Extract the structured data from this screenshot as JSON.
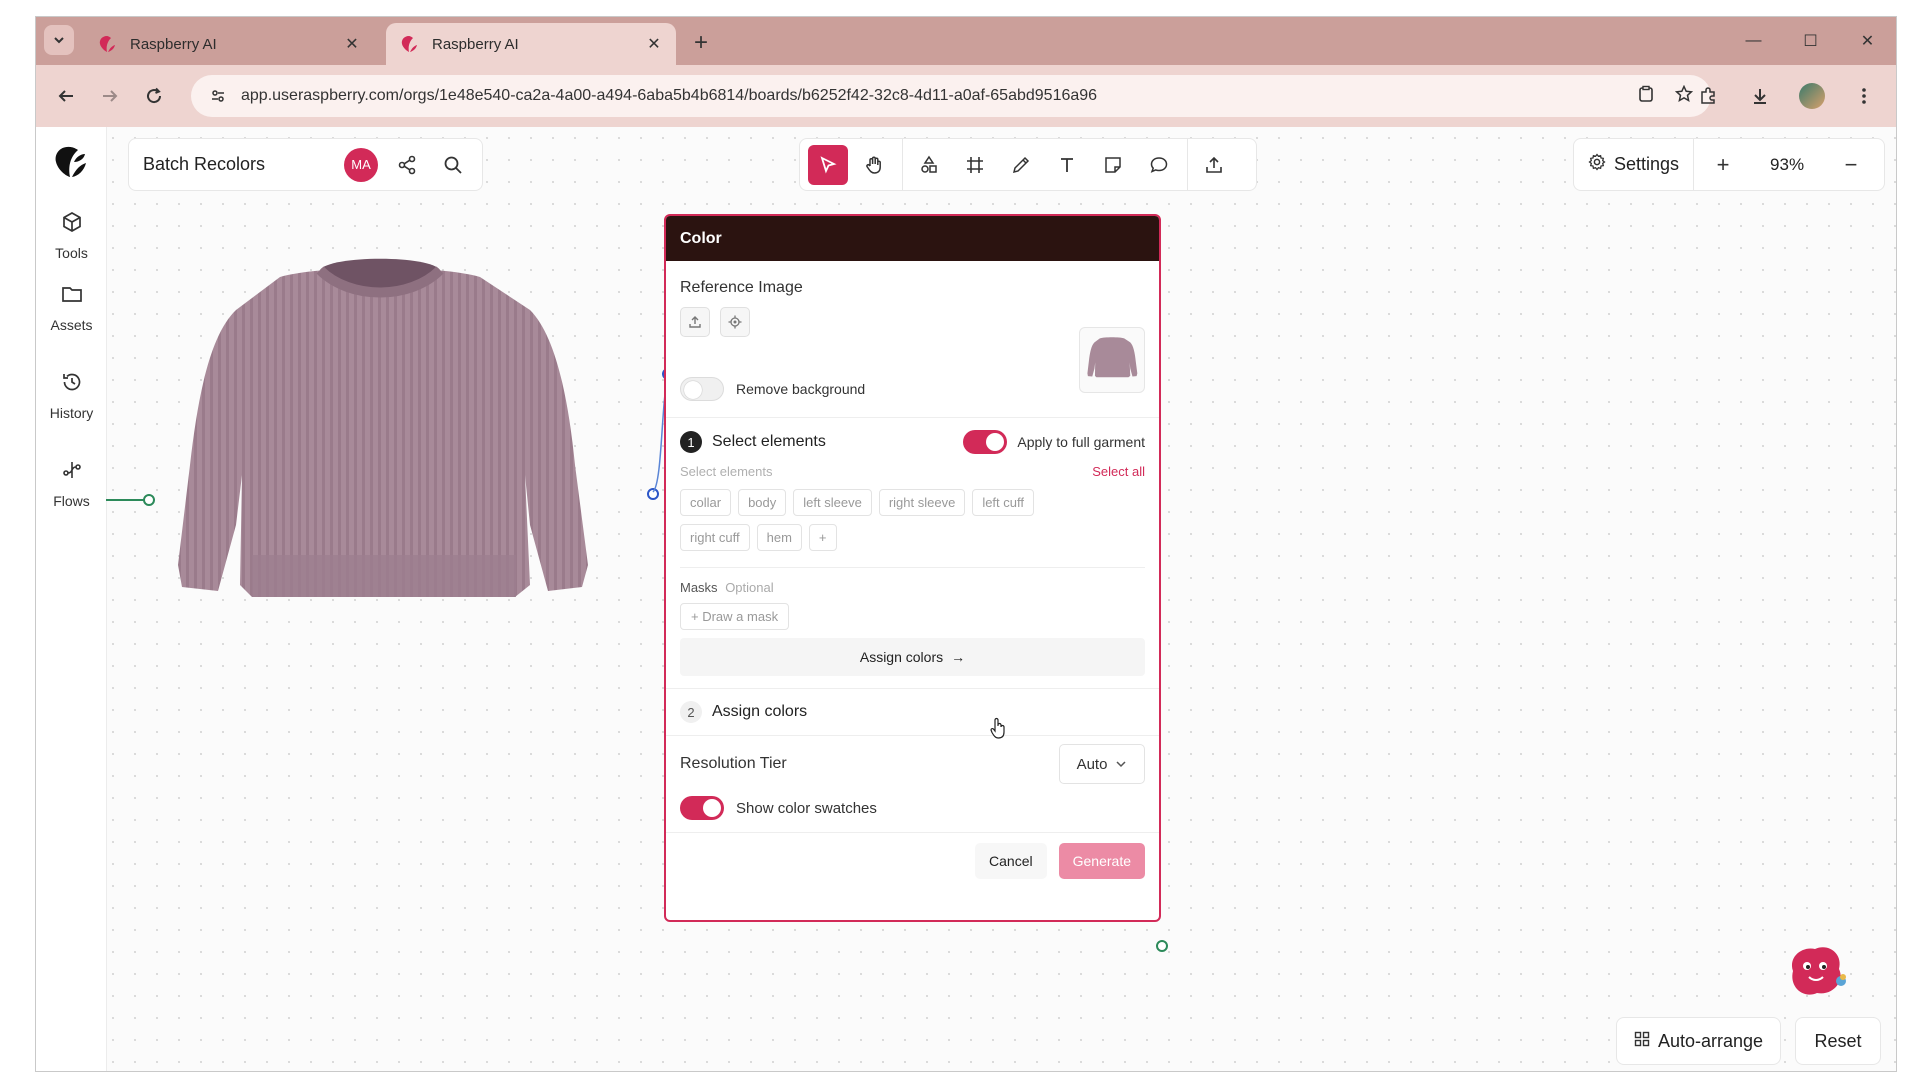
{
  "browser": {
    "tabs": [
      {
        "title": "Raspberry AI",
        "active": false
      },
      {
        "title": "Raspberry AI",
        "active": true
      }
    ],
    "url": "app.useraspberry.com/orgs/1e48e540-ca2a-4a00-a494-6aba5b4b6814/boards/b6252f42-32c8-4d11-a0af-65abd9516a96"
  },
  "sidebar": {
    "items": [
      {
        "label": "Tools",
        "icon": "tools-icon"
      },
      {
        "label": "Assets",
        "icon": "folder-icon"
      },
      {
        "label": "History",
        "icon": "history-icon"
      },
      {
        "label": "Flows",
        "icon": "flows-icon"
      }
    ]
  },
  "board": {
    "title": "Batch Recolors",
    "user_initials": "MA"
  },
  "top_right": {
    "settings_label": "Settings",
    "zoom": "93%"
  },
  "panel": {
    "title": "Color",
    "reference_label": "Reference Image",
    "remove_bg_label": "Remove background",
    "remove_bg_on": false,
    "step1_num": "1",
    "step1_label": "Select elements",
    "apply_full_label": "Apply to full garment",
    "apply_full_on": true,
    "select_elements_hint": "Select elements",
    "select_all": "Select all",
    "chips": [
      "collar",
      "body",
      "left sleeve",
      "right sleeve",
      "left cuff",
      "right cuff",
      "hem"
    ],
    "add_chip": "+",
    "masks_label": "Masks",
    "masks_optional": "Optional",
    "draw_mask": "Draw a mask",
    "assign_btn": "Assign colors",
    "step2_num": "2",
    "step2_label": "Assign colors",
    "resolution_label": "Resolution Tier",
    "resolution_value": "Auto",
    "swatches_label": "Show color swatches",
    "swatches_on": true,
    "cancel": "Cancel",
    "generate": "Generate"
  },
  "bottom": {
    "auto_arrange": "Auto-arrange",
    "reset": "Reset"
  },
  "colors": {
    "brand": "#d22a58",
    "tabbar": "#cb9f9a",
    "panel_header": "#2b1310",
    "sweater": "#a88a99"
  }
}
